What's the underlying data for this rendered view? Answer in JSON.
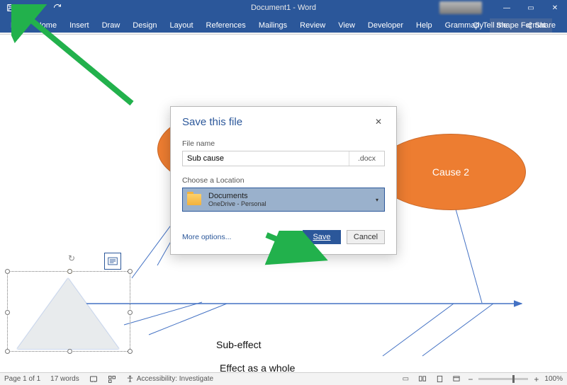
{
  "titlebar": {
    "app_title": "Document1 - Word"
  },
  "qat": {
    "save_icon": "save",
    "undo_icon": "undo",
    "redo_icon": "redo",
    "more_icon": "more"
  },
  "window_controls": {
    "min": "—",
    "max": "▭",
    "close": "✕"
  },
  "ribbon": {
    "tabs": [
      "File",
      "Home",
      "Insert",
      "Draw",
      "Design",
      "Layout",
      "References",
      "Mailings",
      "Review",
      "View",
      "Developer",
      "Help",
      "Grammarly",
      "Shape Format"
    ],
    "tell_me": "Tell me",
    "share": "Share"
  },
  "document": {
    "cause2_label": "Cause 2",
    "sub_effect": "Sub-effect",
    "effect_whole": "Effect as a whole"
  },
  "dialog": {
    "title": "Save this file",
    "file_name_label": "File name",
    "file_name_value": "Sub cause",
    "file_ext": ".docx",
    "location_label": "Choose a Location",
    "location_name": "Documents",
    "location_sub": "OneDrive - Personal",
    "more_options": "More options...",
    "save_btn": "Save",
    "cancel_btn": "Cancel"
  },
  "statusbar": {
    "page": "Page 1 of 1",
    "words": "17 words",
    "accessibility": "Accessibility: Investigate",
    "zoom_pct": "100%"
  },
  "colors": {
    "titlebar": "#2b579a",
    "accent": "#2b579a",
    "orange": "#ed7d31",
    "arrow_green": "#22b14c"
  }
}
